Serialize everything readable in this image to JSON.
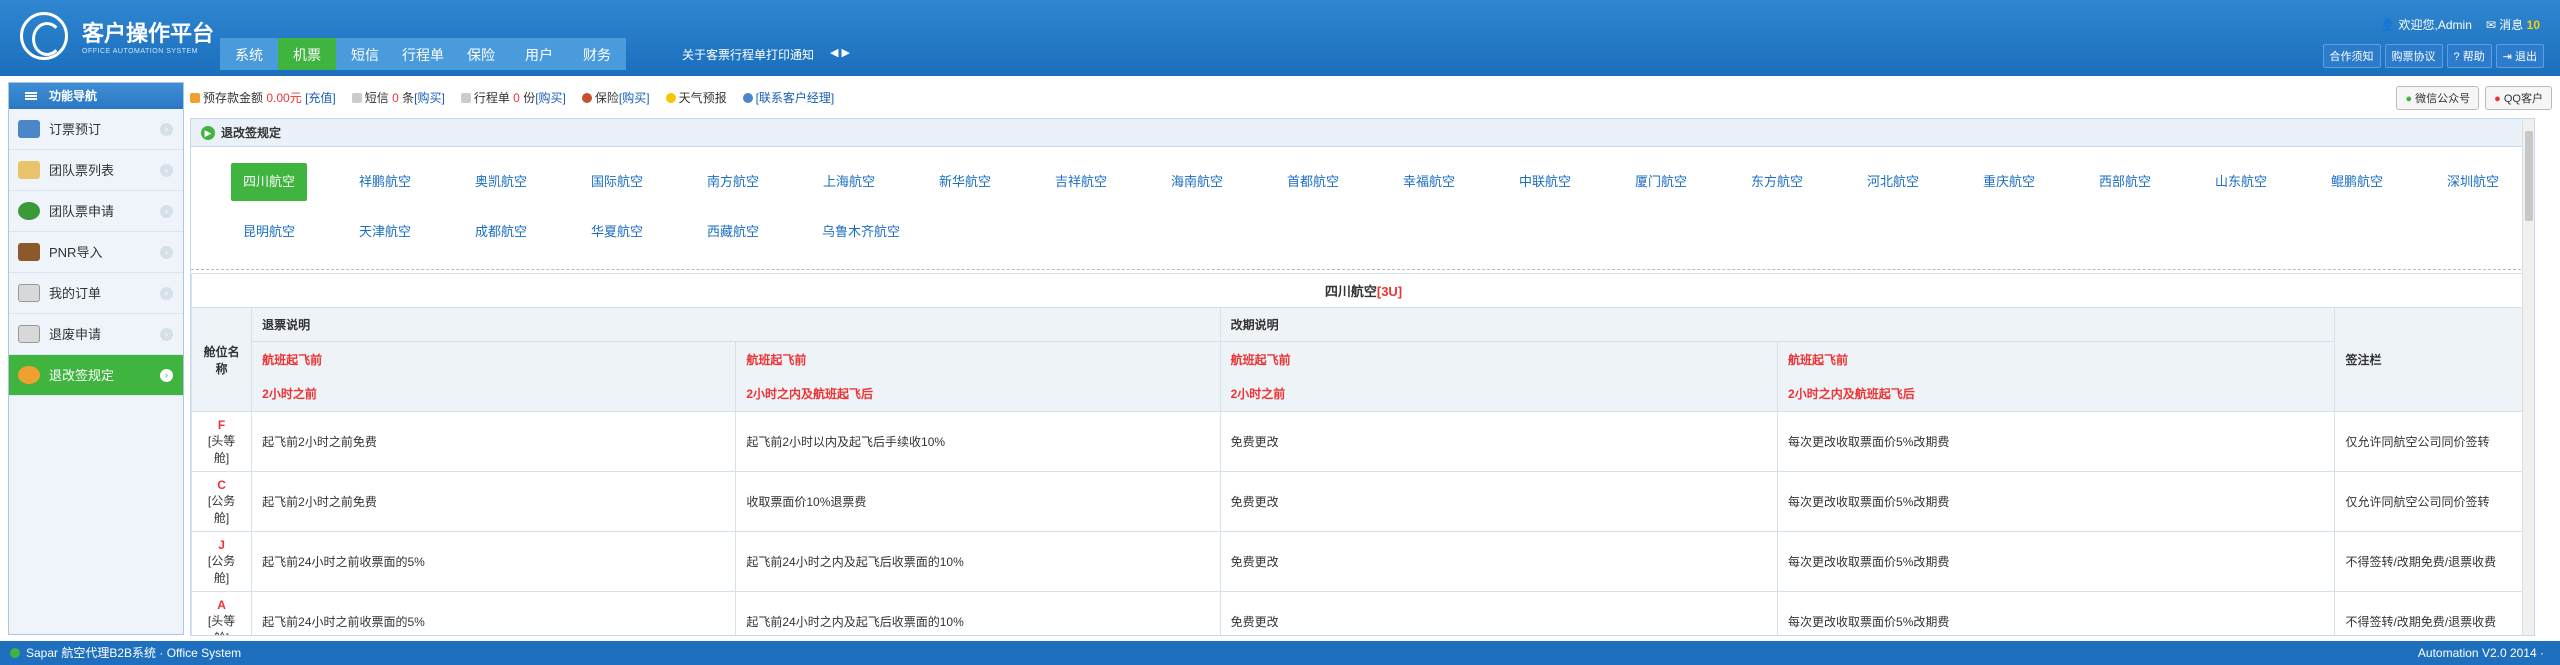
{
  "header": {
    "title": "客户操作平台",
    "subtitle": "OFFICE AUTOMATION SYSTEM",
    "nav": [
      "系统",
      "机票",
      "短信",
      "行程单",
      "保险",
      "用户",
      "财务"
    ],
    "nav_active": "机票",
    "notice": "关于客票行程单打印通知",
    "welcome": "欢迎您,Admin",
    "messages_label": "消息",
    "messages_count": "10",
    "buttons": [
      "合作须知",
      "购票协议",
      "帮助",
      "退出"
    ]
  },
  "sidebar": {
    "title": "功能导航",
    "items": [
      {
        "label": "订票预订",
        "icon": "monitor-icon"
      },
      {
        "label": "团队票列表",
        "icon": "notepad-icon"
      },
      {
        "label": "团队票申请",
        "icon": "tree-icon"
      },
      {
        "label": "PNR导入",
        "icon": "book-icon"
      },
      {
        "label": "我的订单",
        "icon": "envelope-icon"
      },
      {
        "label": "退废申请",
        "icon": "envelope-icon"
      },
      {
        "label": "退改签规定",
        "icon": "people-icon"
      }
    ],
    "active": "退改签规定"
  },
  "infobar": {
    "deposit_label": "预存款金额",
    "deposit_value": "0.00元",
    "recharge": "[充值]",
    "sms_label": "短信",
    "sms_count": "0",
    "sms_unit": "条",
    "sms_buy": "[购买]",
    "itin_label": "行程单",
    "itin_count": "0",
    "itin_unit": "份",
    "itin_buy": "[购买]",
    "insurance_label": "保险",
    "insurance_buy": "[购买]",
    "weather": "天气预报",
    "contact": "[联系客户经理]",
    "wechat": "微信公众号",
    "qq": "QQ客户"
  },
  "panel": {
    "title": "退改签规定",
    "airlines_row1": [
      "四川航空",
      "祥鹏航空",
      "奥凯航空",
      "国际航空",
      "南方航空",
      "上海航空",
      "新华航空",
      "吉祥航空",
      "海南航空",
      "首都航空",
      "幸福航空",
      "中联航空",
      "厦门航空",
      "东方航空",
      "河北航空",
      "重庆航空",
      "西部航空",
      "山东航空",
      "鲲鹏航空",
      "深圳航空"
    ],
    "airlines_row2": [
      "昆明航空",
      "天津航空",
      "成都航空",
      "华夏航空",
      "西藏航空",
      "乌鲁木齐航空"
    ],
    "active_airline": "四川航空"
  },
  "table": {
    "caption_name": "四川航空",
    "caption_code": "[3U]",
    "col_cabin": "舱位名称",
    "col_refund": "退票说明",
    "col_change": "改期说明",
    "col_endorse": "签注栏",
    "sub1_a": "航班起飞前",
    "sub1_b": "2小时之前",
    "sub2_a": "航班起飞前",
    "sub2_b": "2小时之内及航班起飞后",
    "sub3_a": "航班起飞前",
    "sub3_b": "2小时之前",
    "sub4_a": "航班起飞前",
    "sub4_b": "2小时之内及航班起飞后",
    "rows": [
      {
        "letter": "F",
        "type": "[头等舱]",
        "r1": "起飞前2小时之前免费",
        "r2": "起飞前2小时以内及起飞后手续收10%",
        "c1": "免费更改",
        "c2": "每次更改收取票面价5%改期费",
        "e": "仅允许同航空公司同价签转"
      },
      {
        "letter": "C",
        "type": "[公务舱]",
        "r1": "起飞前2小时之前免费",
        "r2": "收取票面价10%退票费",
        "c1": "免费更改",
        "c2": "每次更改收取票面价5%改期费",
        "e": "仅允许同航空公司同价签转"
      },
      {
        "letter": "J",
        "type": "[公务舱]",
        "r1": "起飞前24小时之前收票面的5%",
        "r2": "起飞前24小时之内及起飞后收票面的10%",
        "c1": "免费更改",
        "c2": "每次更改收取票面价5%改期费",
        "e": "不得签转/改期免费/退票收费"
      },
      {
        "letter": "A",
        "type": "[头等舱]",
        "r1": "起飞前24小时之前收票面的5%",
        "r2": "起飞前24小时之内及起飞后收票面的10%",
        "c1": "免费更改",
        "c2": "每次更改收取票面价5%改期费",
        "e": "不得签转/改期免费/退票收费"
      }
    ]
  },
  "footer": {
    "left": "Sapar 航空代理B2B系统 · Office System",
    "right": "Automation V2.0 2014 ·"
  }
}
